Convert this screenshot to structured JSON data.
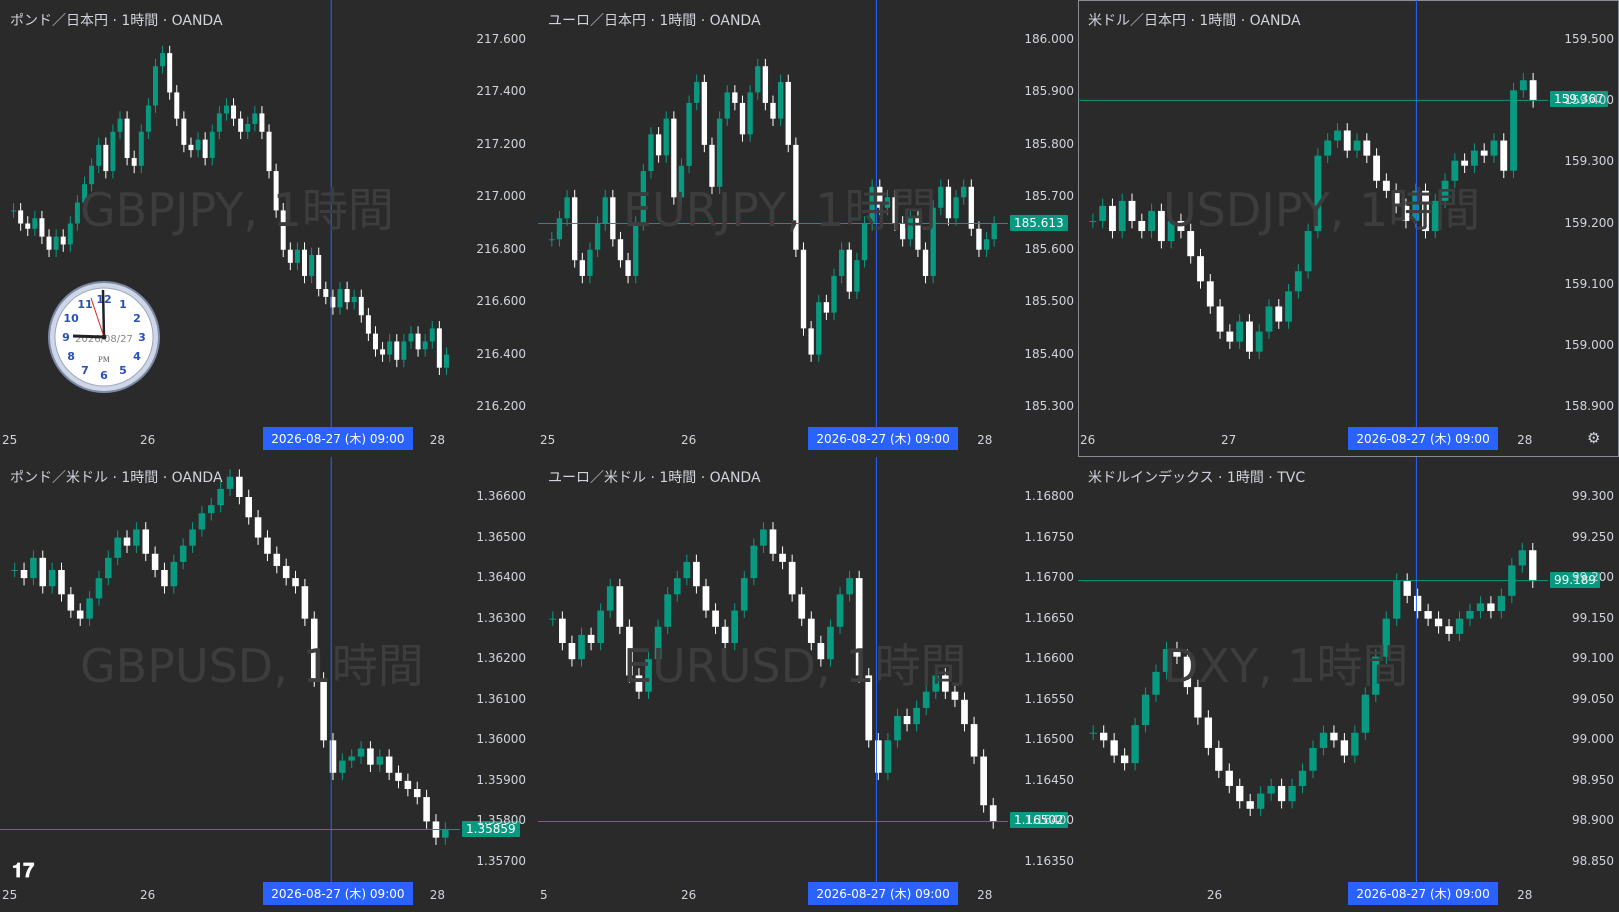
{
  "layout": {
    "cols": 3,
    "rows": 2
  },
  "colors": {
    "up": "#089981",
    "down": "#ffffff",
    "cursor": "#2962ff",
    "priceline": "#089981",
    "bg": "#2a2a2a"
  },
  "clock": {
    "date": "2026/08/27",
    "ampm": "PM",
    "numerals": [
      "12",
      "1",
      "2",
      "3",
      "4",
      "5",
      "6",
      "7",
      "8",
      "9",
      "10",
      "11"
    ]
  },
  "panes": [
    {
      "title": "ポンド／日本円 · 1時間 · OANDA",
      "watermark": "GBPJPY, 1時間",
      "y_labels": [
        "217.600",
        "217.400",
        "217.200",
        "217.000",
        "216.800",
        "216.600",
        "216.400",
        "216.200"
      ],
      "x_labels": [
        "25",
        "26",
        "28"
      ],
      "cursor_time": "2026-08-27 (木)   09:00",
      "price_tag": "",
      "chart_data": {
        "type": "candlestick",
        "ylim": [
          216.2,
          217.6
        ],
        "close": [
          216.95,
          216.9,
          216.88,
          216.92,
          216.85,
          216.8,
          216.85,
          216.82,
          216.9,
          216.98,
          217.05,
          217.12,
          217.2,
          217.1,
          217.25,
          217.3,
          217.15,
          217.12,
          217.25,
          217.35,
          217.5,
          217.55,
          217.4,
          217.3,
          217.2,
          217.18,
          217.22,
          217.15,
          217.25,
          217.32,
          217.35,
          217.3,
          217.25,
          217.28,
          217.32,
          217.25,
          217.1,
          216.95,
          216.8,
          216.75,
          216.8,
          216.7,
          216.78,
          216.65,
          216.62,
          216.58,
          216.65,
          216.6,
          216.62,
          216.55,
          216.48,
          216.42,
          216.4,
          216.45,
          216.38,
          216.45,
          216.48,
          216.42,
          216.45,
          216.5,
          216.35,
          216.4
        ]
      }
    },
    {
      "title": "ユーロ／日本円 · 1時間 · OANDA",
      "watermark": "EURJPY, 1時間",
      "y_labels": [
        "186.000",
        "185.900",
        "185.800",
        "185.700",
        "185.600",
        "185.500",
        "185.400",
        "185.300"
      ],
      "x_labels": [
        "25",
        "26",
        "28"
      ],
      "cursor_time": "2026-08-27 (木)   09:00",
      "price_tag": "185.613",
      "chart_data": {
        "type": "candlestick",
        "ylim": [
          185.3,
          186.0
        ],
        "close": [
          185.62,
          185.66,
          185.7,
          185.58,
          185.55,
          185.6,
          185.65,
          185.7,
          185.62,
          185.58,
          185.55,
          185.65,
          185.75,
          185.82,
          185.78,
          185.85,
          185.7,
          185.76,
          185.88,
          185.92,
          185.8,
          185.72,
          185.85,
          185.9,
          185.88,
          185.82,
          185.9,
          185.95,
          185.88,
          185.85,
          185.92,
          185.8,
          185.6,
          185.45,
          185.4,
          185.5,
          185.48,
          185.55,
          185.6,
          185.52,
          185.58,
          185.65,
          185.72,
          185.68,
          185.7,
          185.65,
          185.62,
          185.66,
          185.6,
          185.55,
          185.68,
          185.72,
          185.66,
          185.7,
          185.72,
          185.64,
          185.6,
          185.62,
          185.65
        ]
      }
    },
    {
      "title": "米ドル／日本円 · 1時間 · OANDA",
      "watermark": "USDJPY, 1時間",
      "y_labels": [
        "159.500",
        "159.400",
        "159.300",
        "159.200",
        "159.100",
        "159.000",
        "158.900"
      ],
      "x_labels": [
        "26",
        "27",
        "28"
      ],
      "cursor_time": "2026-08-27 (木)   09:00",
      "price_tag": "159.367",
      "active": true,
      "chart_data": {
        "type": "candlestick",
        "ylim": [
          158.85,
          159.58
        ],
        "close": [
          159.22,
          159.25,
          159.2,
          159.26,
          159.22,
          159.2,
          159.24,
          159.18,
          159.22,
          159.2,
          159.15,
          159.1,
          159.05,
          159.0,
          158.98,
          159.02,
          158.96,
          159.0,
          159.05,
          159.02,
          159.08,
          159.12,
          159.2,
          159.35,
          159.38,
          159.4,
          159.36,
          159.38,
          159.35,
          159.3,
          159.28,
          159.25,
          159.22,
          159.28,
          159.2,
          159.26,
          159.3,
          159.34,
          159.33,
          159.36,
          159.35,
          159.38,
          159.32,
          159.48,
          159.5,
          159.46
        ]
      }
    },
    {
      "title": "ポンド／米ドル · 1時間 · OANDA",
      "watermark": "GBPUSD, 1時間",
      "y_labels": [
        "1.36600",
        "1.36500",
        "1.36400",
        "1.36300",
        "1.36200",
        "1.36100",
        "1.36000",
        "1.35900",
        "1.35800",
        "1.35700"
      ],
      "x_labels": [
        "25",
        "26",
        "28"
      ],
      "cursor_time": "2026-08-27 (木)   09:00",
      "price_tag": "1.35859",
      "chart_data": {
        "type": "candlestick",
        "ylim": [
          1.357,
          1.366
        ],
        "close": [
          1.3642,
          1.364,
          1.3645,
          1.3638,
          1.3642,
          1.3636,
          1.3632,
          1.363,
          1.3635,
          1.364,
          1.3645,
          1.365,
          1.3648,
          1.3652,
          1.3646,
          1.3642,
          1.3638,
          1.3644,
          1.3648,
          1.3652,
          1.3656,
          1.3658,
          1.3662,
          1.3665,
          1.366,
          1.3655,
          1.365,
          1.3646,
          1.3643,
          1.364,
          1.3638,
          1.363,
          1.3615,
          1.36,
          1.3592,
          1.3595,
          1.3596,
          1.3598,
          1.3594,
          1.3596,
          1.3592,
          1.359,
          1.3588,
          1.3586,
          1.358,
          1.3576,
          1.3578
        ]
      }
    },
    {
      "title": "ユーロ／米ドル · 1時間 · OANDA",
      "watermark": "EURUSD, 1時間",
      "y_labels": [
        "1.16800",
        "1.16750",
        "1.16700",
        "1.16650",
        "1.16600",
        "1.16550",
        "1.16500",
        "1.16450",
        "1.16400",
        "1.16350"
      ],
      "x_labels": [
        "5",
        "26",
        "28"
      ],
      "cursor_time": "2026-08-27 (木)   09:00",
      "price_tag": "1.16502",
      "chart_data": {
        "type": "candlestick",
        "ylim": [
          1.1635,
          1.168
        ],
        "close": [
          1.1665,
          1.1662,
          1.166,
          1.1663,
          1.1662,
          1.1666,
          1.1669,
          1.1664,
          1.1658,
          1.1656,
          1.166,
          1.1664,
          1.1668,
          1.167,
          1.1672,
          1.1669,
          1.1666,
          1.1664,
          1.1662,
          1.1666,
          1.167,
          1.1674,
          1.1676,
          1.1673,
          1.1672,
          1.1668,
          1.1665,
          1.1662,
          1.166,
          1.1664,
          1.1668,
          1.167,
          1.1658,
          1.165,
          1.1646,
          1.165,
          1.1653,
          1.1652,
          1.1654,
          1.1656,
          1.1658,
          1.1656,
          1.1655,
          1.1652,
          1.1648,
          1.1642,
          1.164
        ]
      }
    },
    {
      "title": "米ドルインデックス · 1時間 · TVC",
      "watermark": "DXY, 1時間",
      "y_labels": [
        "99.300",
        "99.250",
        "99.200",
        "99.150",
        "99.100",
        "99.050",
        "99.000",
        "98.950",
        "98.900",
        "98.850"
      ],
      "x_labels": [
        "26",
        "28"
      ],
      "cursor_time": "2026-08-27 (木)   09:00",
      "price_tag": "99.189",
      "chart_data": {
        "type": "candlestick",
        "ylim": [
          98.83,
          99.31
        ],
        "close": [
          99.0,
          98.99,
          98.97,
          98.96,
          99.01,
          99.05,
          99.08,
          99.11,
          99.1,
          99.06,
          99.02,
          98.98,
          98.95,
          98.93,
          98.91,
          98.9,
          98.92,
          98.93,
          98.91,
          98.93,
          98.95,
          98.98,
          99.0,
          98.99,
          98.97,
          99.0,
          99.05,
          99.1,
          99.15,
          99.2,
          99.18,
          99.16,
          99.15,
          99.14,
          99.13,
          99.15,
          99.16,
          99.17,
          99.16,
          99.18,
          99.22,
          99.24,
          99.2
        ]
      }
    }
  ]
}
